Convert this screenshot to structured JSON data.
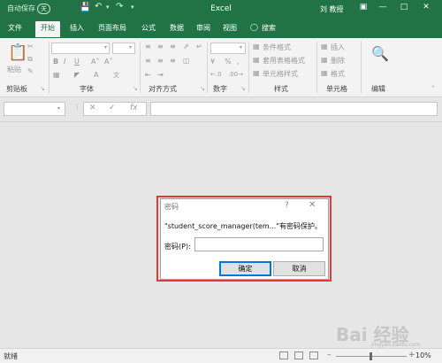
{
  "titlebar": {
    "autosave_label": "自动保存",
    "autosave_state": "关",
    "title": "Excel",
    "user": "刘 教授",
    "bg": "#217346"
  },
  "ribbon_tabs": [
    {
      "label": "文件"
    },
    {
      "label": "开始",
      "active": true
    },
    {
      "label": "插入"
    },
    {
      "label": "页面布局"
    },
    {
      "label": "公式"
    },
    {
      "label": "数据"
    },
    {
      "label": "审阅"
    },
    {
      "label": "视图"
    },
    {
      "label": "搜索"
    }
  ],
  "ribbon": {
    "paste_label": "粘贴",
    "percent": "%",
    "conditional_format": "条件格式",
    "table_format": "套用表格格式",
    "cell_style": "单元格样式",
    "insert": "插入",
    "delete": "删除",
    "format": "格式",
    "groups": {
      "clipboard": "剪贴板",
      "font": "字体",
      "alignment": "对齐方式",
      "number": "数字",
      "styles": "样式",
      "cells": "单元格",
      "editing": "编辑"
    }
  },
  "formula_bar": {
    "fx": "fx"
  },
  "dialog": {
    "title": "密码",
    "message": "\"student_score_manager(tem...\"有密码保护。",
    "password_label": "密码(P):",
    "password_value": "",
    "ok_label": "确定",
    "cancel_label": "取消",
    "highlight_color": "#e53935"
  },
  "statusbar": {
    "ready": "就绪",
    "zoom": "10%"
  },
  "watermark": {
    "text": "Bai 经验",
    "sub": "jingyan.baidu.com"
  }
}
